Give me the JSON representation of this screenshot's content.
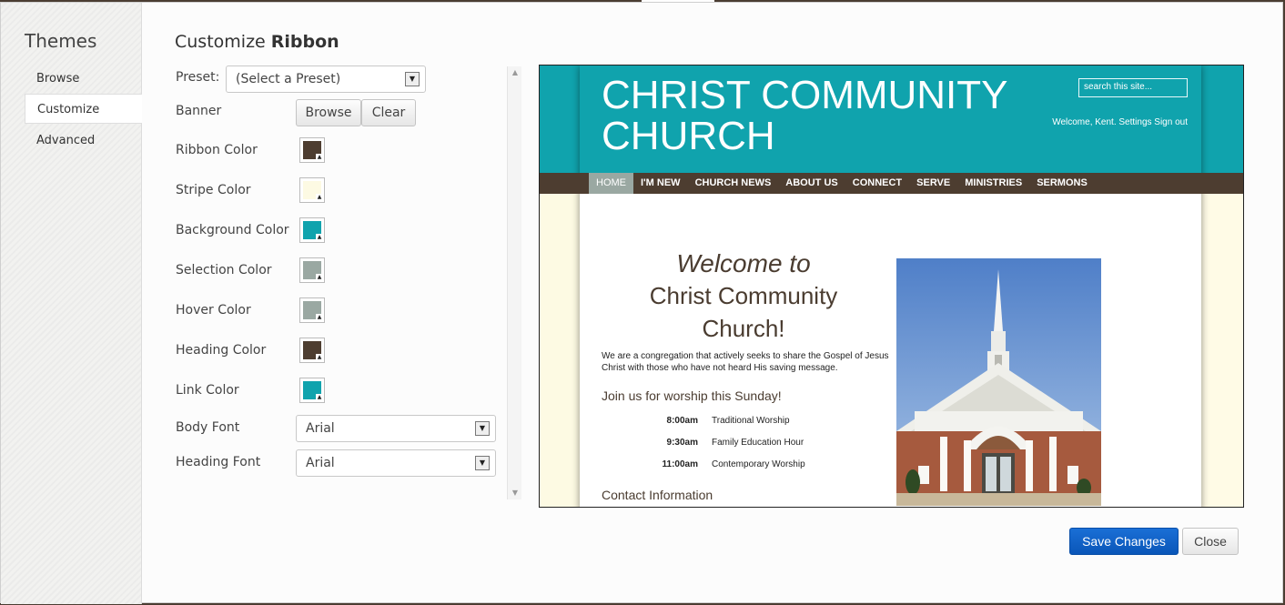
{
  "sidebar": {
    "title": "Themes",
    "items": [
      {
        "label": "Browse"
      },
      {
        "label": "Customize",
        "active": true
      },
      {
        "label": "Advanced"
      }
    ]
  },
  "main": {
    "heading_prefix": "Customize",
    "heading_bold": "Ribbon",
    "preset": {
      "label": "Preset:",
      "value": "(Select a Preset)"
    },
    "banner": {
      "label": "Banner",
      "browse_label": "Browse",
      "clear_label": "Clear"
    },
    "colors": [
      {
        "label": "Ribbon Color",
        "color": "#4d3d30"
      },
      {
        "label": "Stripe Color",
        "color": "#fdfae3"
      },
      {
        "label": "Background Color",
        "color": "#10a3ad"
      },
      {
        "label": "Selection Color",
        "color": "#9aa8a2"
      },
      {
        "label": "Hover Color",
        "color": "#9aa8a2"
      },
      {
        "label": "Heading Color",
        "color": "#4d3d30"
      },
      {
        "label": "Link Color",
        "color": "#10a3ad"
      }
    ],
    "body_font": {
      "label": "Body Font",
      "value": "Arial"
    },
    "heading_font": {
      "label": "Heading Font",
      "value": "Arial"
    }
  },
  "preview": {
    "site_title": "CHRIST COMMUNITY CHURCH",
    "search_placeholder": "search this site...",
    "welcome_user": "Welcome, Kent. Settings Sign out",
    "nav": [
      "HOME",
      "I'M NEW",
      "CHURCH NEWS",
      "ABOUT US",
      "CONNECT",
      "SERVE",
      "MINISTRIES",
      "SERMONS"
    ],
    "welcome_line1": "Welcome to",
    "welcome_line2": "Christ Community",
    "welcome_line3": "Church!",
    "intro": "We are a congregation that actively seeks to share the Gospel of Jesus Christ with those who have not heard His saving message.",
    "join_heading": "Join us for worship this Sunday!",
    "schedule": [
      {
        "time": "8:00am",
        "desc": "Traditional Worship"
      },
      {
        "time": "9:30am",
        "desc": "Family Education Hour"
      },
      {
        "time": "11:00am",
        "desc": "Contemporary Worship"
      }
    ],
    "contact_heading": "Contact Information"
  },
  "footer": {
    "save_label": "Save Changes",
    "close_label": "Close"
  }
}
